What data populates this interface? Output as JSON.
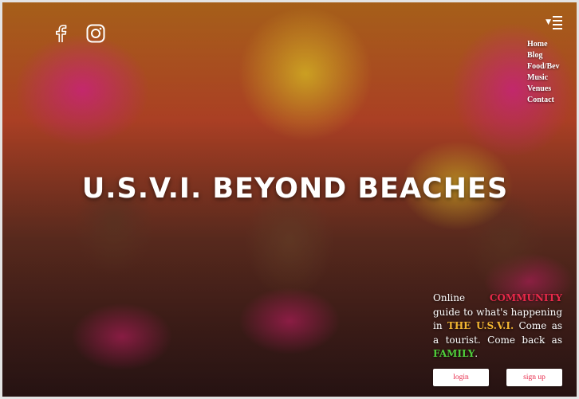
{
  "social": {
    "facebook_icon": "facebook-icon",
    "instagram_icon": "instagram-icon"
  },
  "menu_toggle_icon": "hamburger-menu-icon",
  "nav": {
    "items": [
      "Home",
      "Blog",
      "Food/Bev",
      "Music",
      "Venues",
      "Contact"
    ]
  },
  "hero": {
    "title": "U.S.V.I. BEYOND BEACHES"
  },
  "tagline": {
    "part1": "Online ",
    "community": "COMMUNITY",
    "part2": " guide to what's happening in ",
    "the_usvi": "THE U.S.V.I.",
    "part3": " Come as a tourist. Come back as ",
    "family": "FAMILY",
    "part4": "."
  },
  "buttons": {
    "login": "login",
    "signup": "sign up"
  },
  "colors": {
    "accent_red": "#e8294a",
    "accent_gold": "#f2b632",
    "accent_green": "#4fcf3b"
  }
}
